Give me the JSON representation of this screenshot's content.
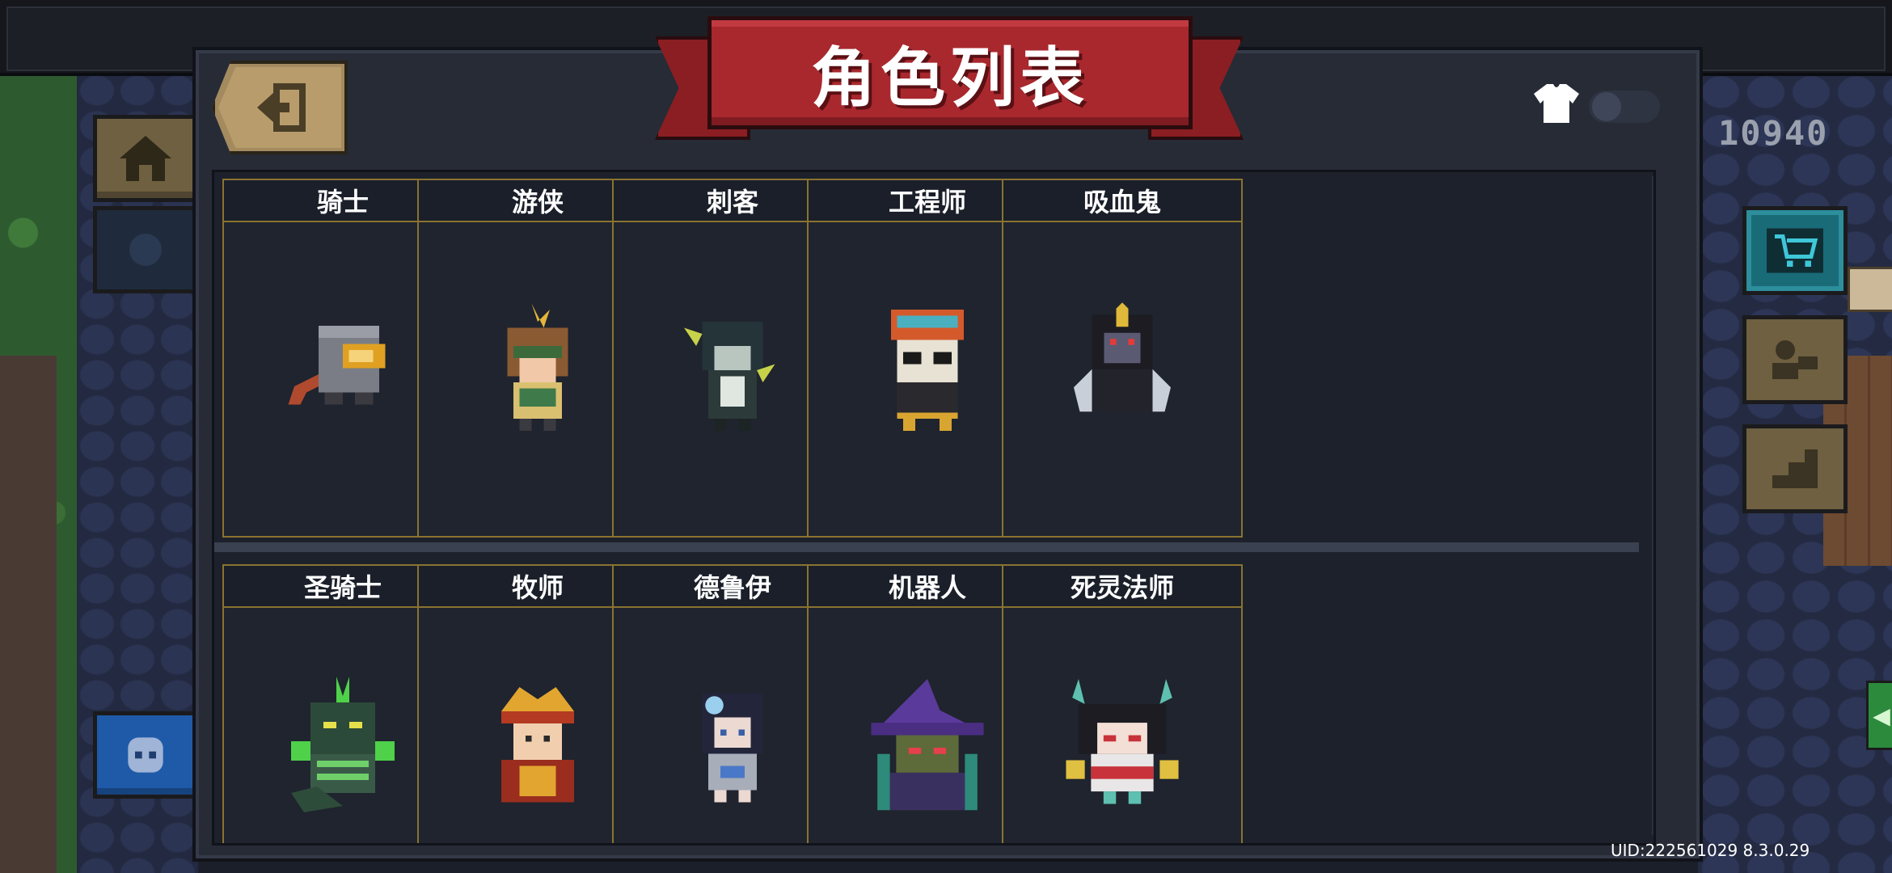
{
  "title": "角色列表",
  "coins": "10940",
  "uid": "UID:222561029 8.3.0.29",
  "skin_toggle": {
    "icon": "shirt-icon",
    "on": false
  },
  "characters": [
    {
      "name": "骑士",
      "icon": "knight-sprite"
    },
    {
      "name": "游侠",
      "icon": "ranger-sprite"
    },
    {
      "name": "刺客",
      "icon": "assassin-sprite"
    },
    {
      "name": "工程师",
      "icon": "engineer-sprite"
    },
    {
      "name": "吸血鬼",
      "icon": "vampire-sprite"
    },
    {
      "name": "圣骑士",
      "icon": "paladin-sprite"
    },
    {
      "name": "牧师",
      "icon": "priest-sprite"
    },
    {
      "name": "德鲁伊",
      "icon": "druid-sprite"
    },
    {
      "name": "机器人",
      "icon": "robot-sprite"
    },
    {
      "name": "死灵法师",
      "icon": "necromancer-sprite"
    }
  ],
  "colors": {
    "ribbon": "#a8282e",
    "card_border": "#8a7330",
    "panel": "#262b36"
  }
}
